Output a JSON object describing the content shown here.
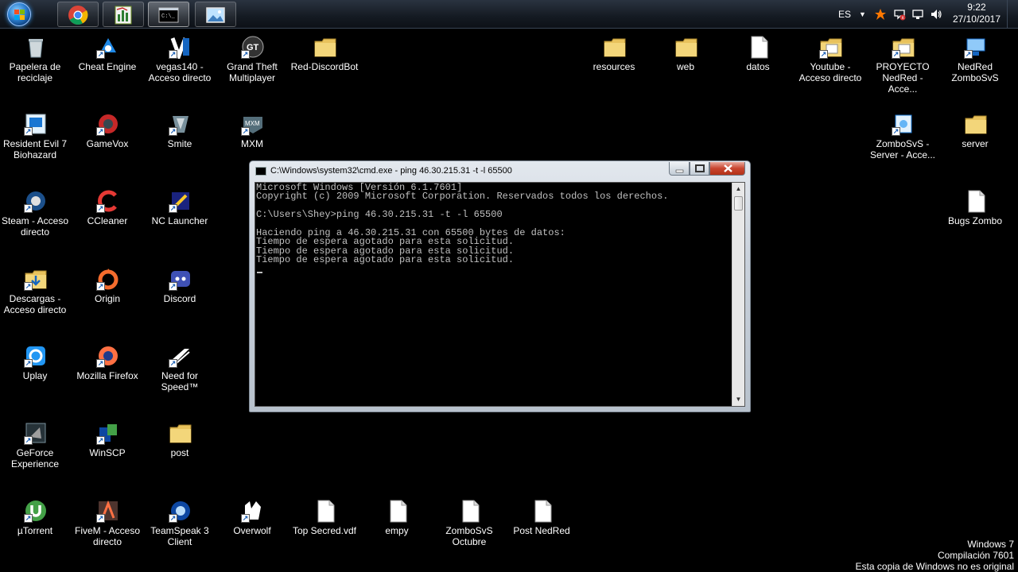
{
  "taskbar": {
    "start_icon": "windows-start-orb",
    "pinned": [
      {
        "name": "chrome",
        "icon": "chrome-icon"
      },
      {
        "name": "app",
        "icon": "spreadsheet-icon"
      },
      {
        "name": "cmd",
        "icon": "console-icon"
      },
      {
        "name": "desktop-app",
        "icon": "picture-icon"
      }
    ],
    "language": "ES",
    "time": "9:22",
    "date": "27/10/2017"
  },
  "desktop_left": [
    {
      "label": "Papelera de reciclaje",
      "icon": "recycle-bin-icon"
    },
    {
      "label": "Cheat Engine",
      "icon": "cheat-engine-icon"
    },
    {
      "label": "vegas140 - Acceso directo",
      "icon": "vegas-icon"
    },
    {
      "label": "Grand Theft Multiplayer",
      "icon": "gtm-icon"
    },
    {
      "label": "Red-DiscordBot",
      "icon": "folder-icon"
    },
    {
      "label": "Resident Evil 7 Biohazard",
      "icon": "game-icon"
    },
    {
      "label": "GameVox",
      "icon": "gamevox-icon"
    },
    {
      "label": "Smite",
      "icon": "smite-icon"
    },
    {
      "label": "MXM",
      "icon": "mxm-icon"
    },
    {
      "label": "Steam - Acceso directo",
      "icon": "steam-icon"
    },
    {
      "label": "CCleaner",
      "icon": "ccleaner-icon"
    },
    {
      "label": "NC Launcher",
      "icon": "nc-launcher-icon"
    },
    {
      "label": "Descargas - Acceso directo",
      "icon": "downloads-folder-icon"
    },
    {
      "label": "Origin",
      "icon": "origin-icon"
    },
    {
      "label": "Discord",
      "icon": "discord-icon"
    },
    {
      "label": "Uplay",
      "icon": "uplay-icon"
    },
    {
      "label": "Mozilla Firefox",
      "icon": "firefox-icon"
    },
    {
      "label": "Need for Speed™",
      "icon": "nfs-icon"
    },
    {
      "label": "GeForce Experience",
      "icon": "geforce-icon"
    },
    {
      "label": "WinSCP",
      "icon": "winscp-icon"
    },
    {
      "label": "post",
      "icon": "folder-icon"
    },
    {
      "label": "µTorrent",
      "icon": "utorrent-icon"
    },
    {
      "label": "FiveM - Acceso directo",
      "icon": "fivem-icon"
    },
    {
      "label": "TeamSpeak 3 Client",
      "icon": "teamspeak-icon"
    },
    {
      "label": "Overwolf",
      "icon": "overwolf-icon"
    },
    {
      "label": "Top Secred.vdf",
      "icon": "file-icon"
    },
    {
      "label": "empy",
      "icon": "file-icon"
    },
    {
      "label": "ZomboSvS Octubre",
      "icon": "file-icon"
    },
    {
      "label": "Post NedRed",
      "icon": "file-icon"
    }
  ],
  "desktop_right": [
    {
      "label": "resources",
      "icon": "folder-icon"
    },
    {
      "label": "web",
      "icon": "folder-icon"
    },
    {
      "label": "datos",
      "icon": "file-icon"
    },
    {
      "label": "Youtube - Acceso directo",
      "icon": "folder-shortcut-icon"
    },
    {
      "label": "PROYECTO NedRed - Acce...",
      "icon": "folder-shortcut-icon"
    },
    {
      "label": "NedRed ZomboSvS",
      "icon": "network-icon"
    },
    {
      "label": "ZomboSvS - Server - Acce...",
      "icon": "server-shortcut-icon"
    },
    {
      "label": "server",
      "icon": "folder-icon"
    },
    {
      "label": "Bugs Zombo",
      "icon": "file-icon"
    }
  ],
  "cmd_window": {
    "title": "C:\\Windows\\system32\\cmd.exe - ping  46.30.215.31 -t -l 65500",
    "lines": [
      "Microsoft Windows [Versión 6.1.7601]",
      "Copyright (c) 2009 Microsoft Corporation. Reservados todos los derechos.",
      "",
      "C:\\Users\\Shey>ping 46.30.215.31 -t -l 65500",
      "",
      "Haciendo ping a 46.30.215.31 con 65500 bytes de datos:",
      "Tiempo de espera agotado para esta solicitud.",
      "Tiempo de espera agotado para esta solicitud.",
      "Tiempo de espera agotado para esta solicitud."
    ]
  },
  "watermark": {
    "line1": "Windows 7",
    "line2": "Compilación  7601",
    "line3": "Esta copia de Windows no es original"
  }
}
